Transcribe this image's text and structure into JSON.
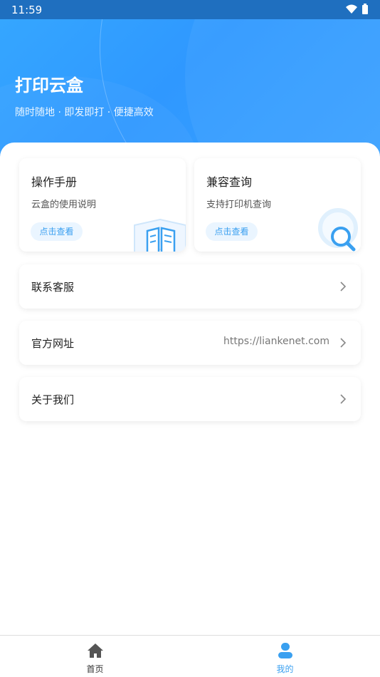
{
  "status_bar": {
    "time": "11:59"
  },
  "header": {
    "title": "打印云盒",
    "subtitle": "随时随地 · 即发即打 · 便捷高效"
  },
  "cards": [
    {
      "title": "操作手册",
      "desc": "云盒的使用说明",
      "button": "点击查看",
      "icon": "open-book-icon"
    },
    {
      "title": "兼容查询",
      "desc": "支持打印机查询",
      "button": "点击查看",
      "icon": "magnifier-icon"
    }
  ],
  "list": {
    "service": {
      "label": "联系客服"
    },
    "website": {
      "label": "官方网址",
      "value": "https://liankenet.com"
    },
    "about": {
      "label": "关于我们"
    }
  },
  "bottom_nav": {
    "home": {
      "label": "首页",
      "icon": "home-icon"
    },
    "mine": {
      "label": "我的",
      "icon": "user-icon"
    }
  },
  "colors": {
    "accent": "#3aa0f0",
    "header": "#2f98ff"
  }
}
